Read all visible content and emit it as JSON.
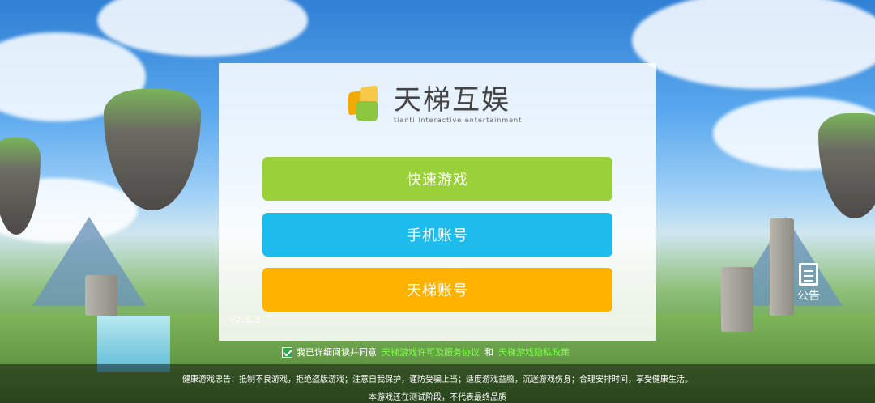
{
  "logo": {
    "name_cn": "天梯互娱",
    "name_en": "tianti interactive entertainment"
  },
  "buttons": {
    "quick_play": "快速游戏",
    "phone_account": "手机账号",
    "tianti_account": "天梯账号"
  },
  "version": "v2.1.3",
  "notice": {
    "label": "公告"
  },
  "agreement": {
    "prefix": "我已详细阅读并同意",
    "license_link": "天梯游戏许可及服务协议",
    "conjunction": "和",
    "privacy_link": "天梯游戏隐私政策",
    "checked": true
  },
  "footer": {
    "health": "健康游戏忠告：抵制不良游戏，拒绝盗版游戏；注意自我保护，谨防受骗上当；适度游戏益脑，沉迷游戏伤身；合理安排时间，享受健康生活。",
    "test": "本游戏还在测试阶段，不代表最终品质"
  },
  "colors": {
    "quick_play": "#9ad13a",
    "phone_account": "#1ebbed",
    "tianti_account": "#ffb300",
    "link": "#7cff4a"
  }
}
